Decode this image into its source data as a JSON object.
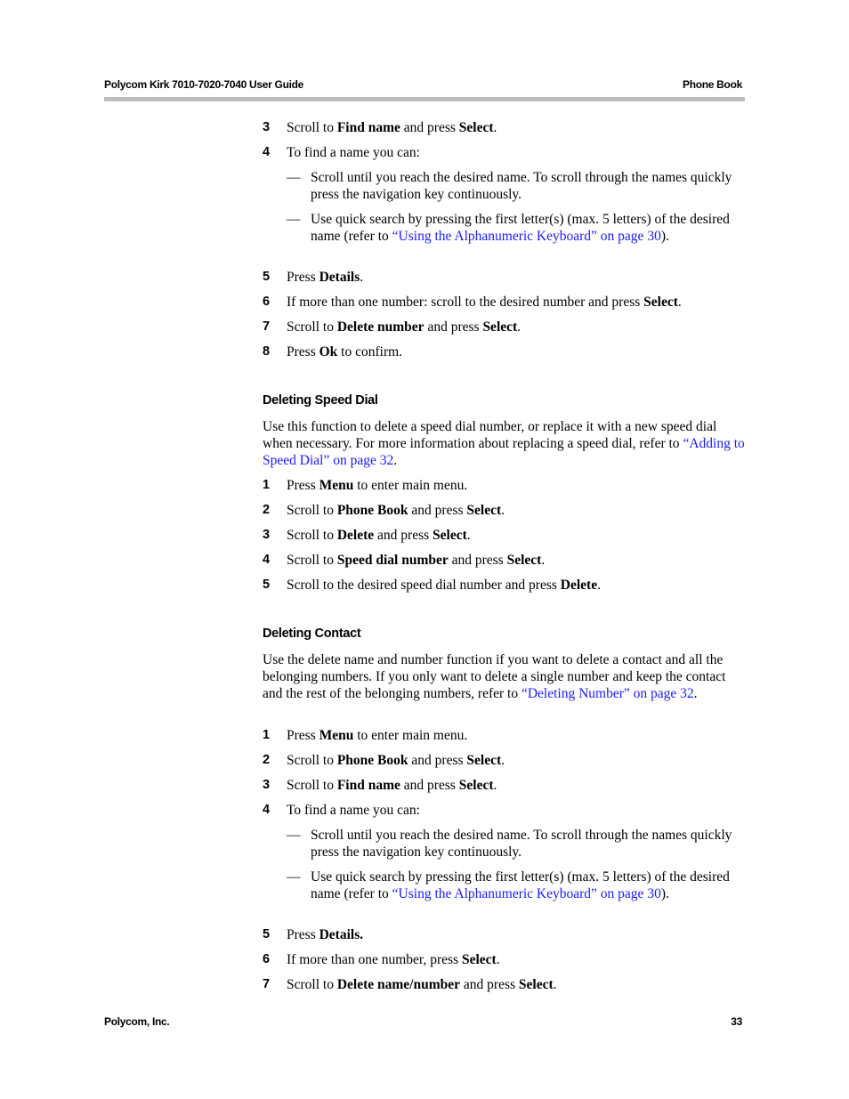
{
  "header": {
    "title": "Polycom Kirk 7010-7020-7040 User Guide",
    "section": "Phone Book"
  },
  "footer": {
    "company": "Polycom, Inc.",
    "page_number": "33"
  },
  "intro_steps": [
    {
      "num": "3",
      "pre": "Scroll to ",
      "b1": "Find name",
      "mid": " and press ",
      "b2": "Select",
      "post": "."
    },
    {
      "num": "4",
      "text": "To find a name you can:"
    },
    {
      "num": "5",
      "pre": "Press ",
      "b1": "Details",
      "post": "."
    },
    {
      "num": "6",
      "pre": "If more than one number: scroll to the desired number and press ",
      "b1": "Select",
      "post": "."
    },
    {
      "num": "7",
      "pre": "Scroll to ",
      "b1": "Delete number",
      "mid": " and press ",
      "b2": "Select",
      "post": "."
    },
    {
      "num": "8",
      "pre": "Press ",
      "b1": "Ok",
      "post": " to confirm."
    }
  ],
  "intro_bullets": [
    {
      "dash": "—",
      "text": "Scroll until you reach the desired name. To scroll through the names quickly press the navigation key continuously."
    },
    {
      "dash": "—",
      "pre": "Use quick search by pressing the first letter(s) (max. 5 letters) of the desired name (refer to ",
      "link": "“Using the Alphanumeric Keyboard” on page 30",
      "post": ")."
    }
  ],
  "speed_dial": {
    "heading": "Deleting Speed Dial",
    "para_pre": "Use this function to delete a speed dial number, or replace it with a new speed dial when necessary. For more information about replacing a speed dial, refer to ",
    "para_link": "“Adding to Speed Dial” on page 32",
    "para_post": ".",
    "steps": [
      {
        "num": "1",
        "pre": "Press ",
        "b1": "Menu",
        "post": " to enter main menu."
      },
      {
        "num": "2",
        "pre": "Scroll to ",
        "b1": "Phone Book",
        "mid": " and press ",
        "b2": "Select",
        "post": "."
      },
      {
        "num": "3",
        "pre": "Scroll to ",
        "b1": "Delete",
        "mid": " and press ",
        "b2": "Select",
        "post": "."
      },
      {
        "num": "4",
        "pre": "Scroll to ",
        "b1": "Speed dial number",
        "mid": " and press ",
        "b2": "Select",
        "post": "."
      },
      {
        "num": "5",
        "pre": "Scroll to the desired speed dial number and press ",
        "b1": "Delete",
        "post": "."
      }
    ]
  },
  "contact": {
    "heading": "Deleting Contact",
    "para_pre": "Use the delete name and number function if you want to delete a contact and all the belonging numbers. If you only want to delete a single number and keep the contact and the rest of the belonging numbers, refer to ",
    "para_link": "“Deleting Number” on page 32",
    "para_post": ".",
    "steps": [
      {
        "num": "1",
        "pre": "Press ",
        "b1": "Menu",
        "post": " to enter main menu."
      },
      {
        "num": "2",
        "pre": "Scroll to ",
        "b1": "Phone Book",
        "mid": " and press ",
        "b2": "Select",
        "post": "."
      },
      {
        "num": "3",
        "pre": "Scroll to ",
        "b1": "Find name",
        "mid": " and press ",
        "b2": "Select",
        "post": "."
      },
      {
        "num": "4",
        "text": "To find a name you can:"
      },
      {
        "num": "5",
        "pre": "Press ",
        "b1": "Details.",
        "post": ""
      },
      {
        "num": "6",
        "pre": "If more than one number, press ",
        "b1": "Select",
        "post": "."
      },
      {
        "num": "7",
        "pre": "Scroll to ",
        "b1": "Delete name/number",
        "mid": " and press ",
        "b2": "Select",
        "post": "."
      }
    ],
    "bullets": [
      {
        "dash": "—",
        "text": "Scroll until you reach the desired name. To scroll through the names quickly press the navigation key continuously."
      },
      {
        "dash": "—",
        "pre": "Use quick search by pressing the first letter(s) (max. 5 letters) of the desired name (refer to ",
        "link": "“Using the Alphanumeric Keyboard” on page 30",
        "post": ")."
      }
    ]
  },
  "colors": {
    "link": "#1a1aff",
    "header_rule": "#bdbdbd"
  }
}
